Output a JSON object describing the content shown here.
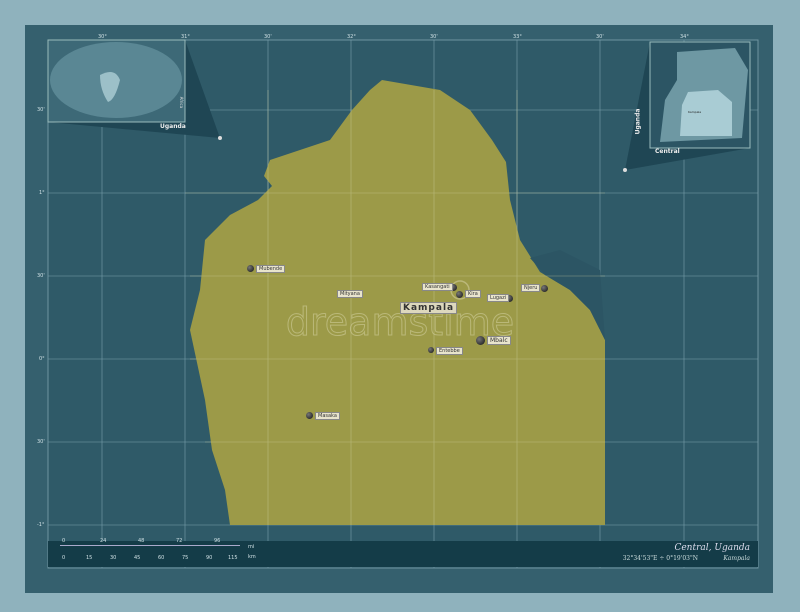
{
  "title": "Central, Uganda",
  "coords": "32°34'53\"E ÷ 0°19'03\"N",
  "capital": "Kampala",
  "inset_world_label": "Uganda",
  "inset_country_label": "Uganda",
  "inset_region_label": "Central",
  "inset_country_city": "Kampala",
  "inset_world_side": "Africa",
  "cities": [
    {
      "name": "Kampala",
      "capital": true
    },
    {
      "name": "Kasangati"
    },
    {
      "name": "Kira"
    },
    {
      "name": "Lugazi"
    },
    {
      "name": "Njeru"
    },
    {
      "name": "Mbalc"
    },
    {
      "name": "Entebbe"
    },
    {
      "name": "Mityana"
    },
    {
      "name": "Mubende"
    },
    {
      "name": "Masaka"
    }
  ],
  "lon_ticks": [
    "30°",
    "31°",
    "30'",
    "32°",
    "30'",
    "33°",
    "30'",
    "34°"
  ],
  "lat_ticks": [
    "30'",
    "1°",
    "30'",
    "0°",
    "30'",
    "-1°"
  ],
  "scale": {
    "mi": [
      "0",
      "24",
      "48",
      "72",
      "96"
    ],
    "km": [
      "0",
      "15",
      "30",
      "45",
      "60",
      "75",
      "90",
      "115"
    ],
    "unit_mi": "mi",
    "unit_km": "km"
  },
  "colors": {
    "region": "#9c9a48",
    "water": "#2c5564",
    "frame": "#35606e"
  }
}
